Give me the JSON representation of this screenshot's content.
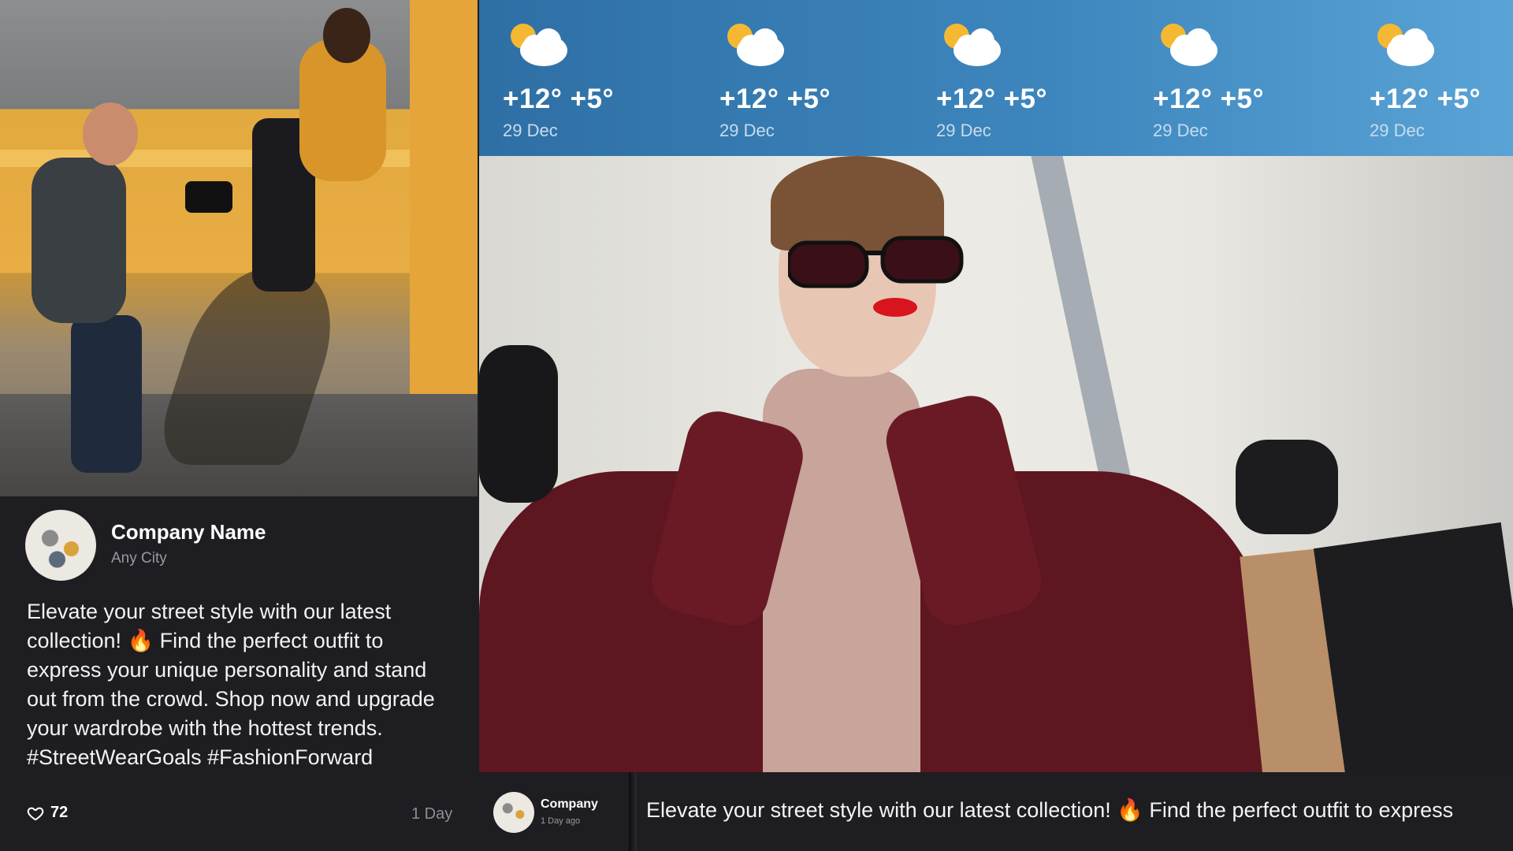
{
  "post": {
    "company_name": "Company Name",
    "city": "Any City",
    "text": "Elevate your street style with our latest collection! 🔥 Find the perfect outfit to express your unique personality and stand out from the crowd. Shop now and upgrade your wardrobe with the hottest trends. #StreetWearGoals #FashionForward",
    "likes": "72",
    "age": "1 Day"
  },
  "weather": {
    "days": [
      {
        "high": "+12°",
        "low": "+5°",
        "date": "29 Dec",
        "icon": "partly-cloudy-icon"
      },
      {
        "high": "+12°",
        "low": "+5°",
        "date": "29 Dec",
        "icon": "partly-cloudy-icon"
      },
      {
        "high": "+12°",
        "low": "+5°",
        "date": "29 Dec",
        "icon": "partly-cloudy-icon"
      },
      {
        "high": "+12°",
        "low": "+5°",
        "date": "29 Dec",
        "icon": "partly-cloudy-icon"
      },
      {
        "high": "+12°",
        "low": "+5°",
        "date": "29 Dec",
        "icon": "partly-cloudy-icon"
      }
    ]
  },
  "ticker": {
    "company": "Company",
    "age": "1 Day ago",
    "text": "Elevate your street style with our latest collection! 🔥 Find the perfect outfit to express"
  },
  "colors": {
    "background": "#1e1d21",
    "weather_start": "#2e6fa4",
    "weather_end": "#5aa3d6"
  }
}
